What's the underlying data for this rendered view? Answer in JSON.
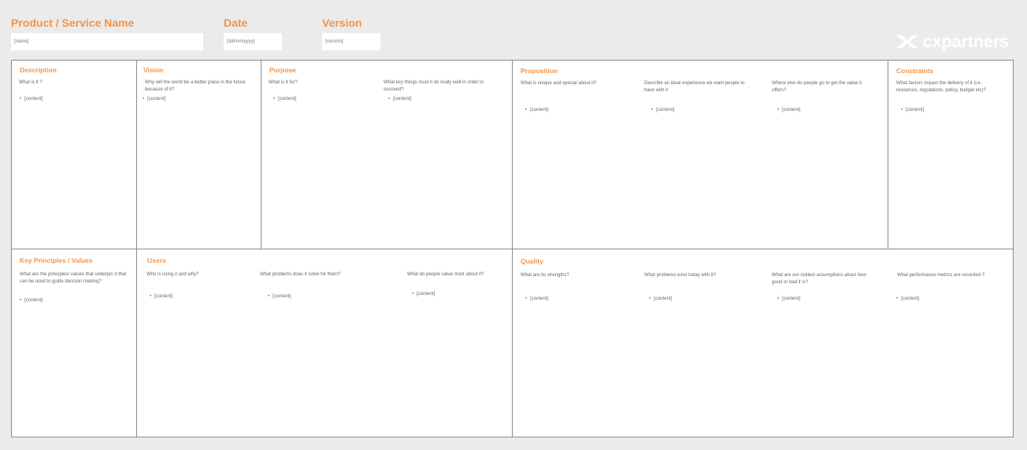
{
  "header": {
    "product_label": "Product / Service Name",
    "product_value": "[name]",
    "date_label": "Date",
    "date_value": "[dd/mm/yyyy]",
    "version_label": "Version",
    "version_value": "[version]",
    "logo_text": "cxpartners"
  },
  "bullet": "•",
  "panels": {
    "description": {
      "title": "Description",
      "q1": "What is it ?",
      "c1": "[content]"
    },
    "vision": {
      "title": "Vision",
      "q1": "Why will the world be a better place in the future because of it?",
      "c1": "[content]"
    },
    "purpose": {
      "title": "Purpose",
      "q1": "What is it for?",
      "q2": "What key things must it do really well in order to succeed?",
      "c1": "[content]",
      "c2": "[content]"
    },
    "proposition": {
      "title": "Proposition",
      "q1": "What is unique and special about it?",
      "q2": "Describe an ideal experience we want people to have with it",
      "q3": "Where else do people go to get the value it offers?",
      "c1": "[content]",
      "c2": "[content]",
      "c3": "[content]"
    },
    "constraints": {
      "title": "Constraints",
      "q1": "What factors impact the delivery of it (i.e. resources, regulations, policy, budget etc)?",
      "c1": "[content]"
    },
    "principles": {
      "title": "Key Principles / Values",
      "q1": "What are the principles/ values that underpin it that can be used to guide decision making?",
      "c1": "[content]"
    },
    "users": {
      "title": "Users",
      "q1": "Who is using it and why?",
      "q2": "What problems does it solve for them?",
      "q3": "What do people value most about it?",
      "c1": "[content]",
      "c2": "[content]",
      "c3": "[content]"
    },
    "quality": {
      "title": "Quality",
      "q1": "What are its strengths?",
      "q2": "What problems exist today with it?",
      "q3": "What are our riskiest assumptions about how good or bad it is?",
      "q4": "What performance metrics are recorded ?",
      "c1": "[content]",
      "c2": "[content]",
      "c3": "[content]",
      "c4": "[content]"
    }
  },
  "colors": {
    "accent": "#f0944d",
    "background": "#ebebeb",
    "panel": "#ffffff",
    "border": "#8a8a8a"
  }
}
